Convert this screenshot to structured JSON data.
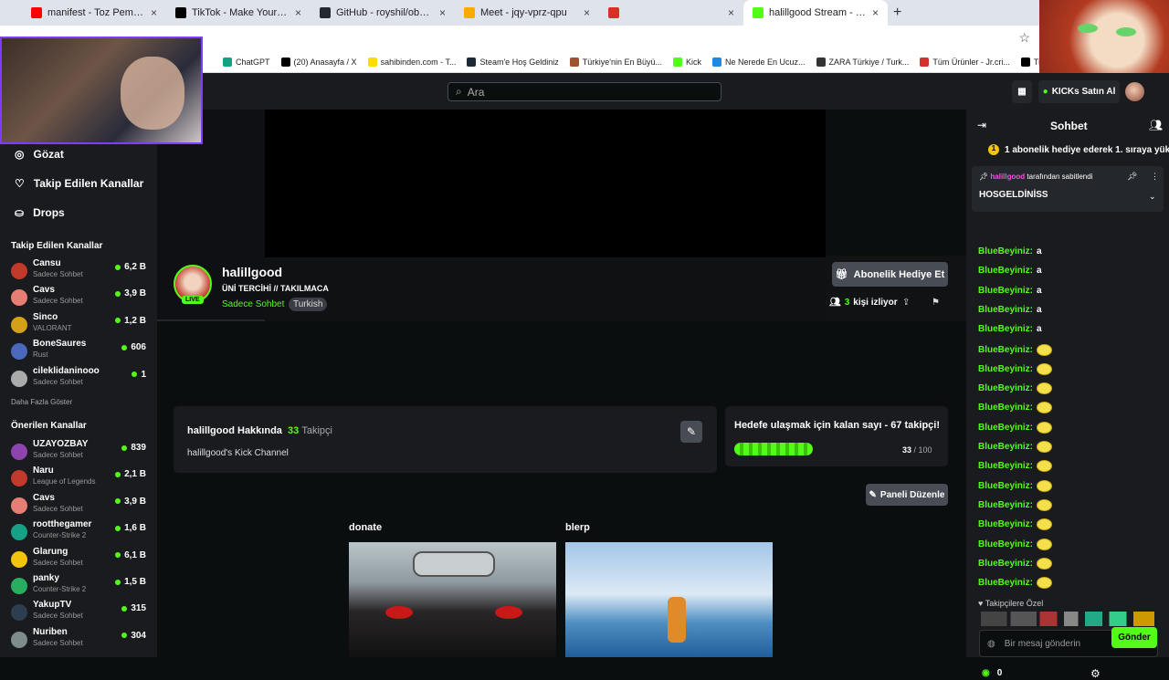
{
  "browser": {
    "tabs": [
      {
        "title": "manifest - Toz Pembe | Official",
        "color": "#ff0000"
      },
      {
        "title": "TikTok - Make Your Day",
        "color": "#000000"
      },
      {
        "title": "GitHub - royshil/obs-backgrou",
        "color": "#24292f"
      },
      {
        "title": "Meet - jqy-vprz-qpu",
        "color": "#f9ab00"
      },
      {
        "title": "",
        "color": "#d93025"
      },
      {
        "title": "halillgood Stream - Watch Live",
        "color": "#53fc18"
      }
    ],
    "bookmarks": [
      "ChatGPT",
      "(20) Anasayfa / X",
      "sahibinden.com - T...",
      "Steam'e Hoş Geldiniz",
      "Türkiye'nin En Büyü...",
      "Kick",
      "Ne Nerede En Ucuz...",
      "ZARA Türkiye / Turk...",
      "Tüm Ürünler - Jr.cri...",
      "TikTok - Make Your..."
    ]
  },
  "nav": {
    "search_placeholder": "Ara",
    "kicks_button": "KICKs Satın Al"
  },
  "sidebar": {
    "browse": "Gözat",
    "followed_nav": "Takip Edilen Kanallar",
    "drops": "Drops",
    "followed_header": "Takip Edilen Kanallar",
    "followed": [
      {
        "name": "Cansu",
        "cat": "Sadece Sohbet",
        "v": "6,2 B",
        "col": "#c0392b"
      },
      {
        "name": "Cavs",
        "cat": "Sadece Sohbet",
        "v": "3,9 B",
        "col": "#e67e73"
      },
      {
        "name": "Sinco",
        "cat": "VALORANT",
        "v": "1,2 B",
        "col": "#d4a017"
      },
      {
        "name": "BoneSaures",
        "cat": "Rust",
        "v": "606",
        "col": "#4a69bd"
      },
      {
        "name": "cileklidaninooo",
        "cat": "Sadece Sohbet",
        "v": "1",
        "col": "#aaaaaa"
      }
    ],
    "show_more": "Daha Fazla Göster",
    "recommended_header": "Önerilen Kanallar",
    "recommended": [
      {
        "name": "UZAYOZBAY",
        "cat": "Sadece Sohbet",
        "v": "839",
        "col": "#8e44ad"
      },
      {
        "name": "Naru",
        "cat": "League of Legends",
        "v": "2,1 B",
        "col": "#c0392b"
      },
      {
        "name": "Cavs",
        "cat": "Sadece Sohbet",
        "v": "3,9 B",
        "col": "#e67e73"
      },
      {
        "name": "rootthegamer",
        "cat": "Counter-Strike 2",
        "v": "1,6 B",
        "col": "#16a085"
      },
      {
        "name": "Glarung",
        "cat": "Sadece Sohbet",
        "v": "6,1 B",
        "col": "#f1c40f"
      },
      {
        "name": "panky",
        "cat": "Counter-Strike 2",
        "v": "1,5 B",
        "col": "#27ae60"
      },
      {
        "name": "YakupTV",
        "cat": "Sadece Sohbet",
        "v": "315",
        "col": "#2c3e50"
      },
      {
        "name": "Nuriben",
        "cat": "Sadece Sohbet",
        "v": "304",
        "col": "#7f8c8d"
      }
    ]
  },
  "stream": {
    "username": "halillgood",
    "title": "ÜNİ TERCİHİ // TAKILMACA",
    "category": "Sadece Sohbet",
    "tag": "Turkish",
    "live": "LIVE",
    "subscribe_gift": "Abonelik Hediye Et",
    "viewers": "3",
    "viewers_label": "kişi izliyor"
  },
  "about": {
    "heading": "halillgood Hakkında",
    "followers": "33",
    "followers_label": "Takipçi",
    "desc": "halillgood's Kick Channel"
  },
  "goal": {
    "text": "Hedefe ulaşmak için kalan sayı - 67 takipçi!",
    "current": "33",
    "target": "/ 100",
    "progress": 0.33
  },
  "panels": {
    "edit": "Paneli Düzenle",
    "items": [
      "donate",
      "blerp"
    ]
  },
  "chat": {
    "title": "Sohbet",
    "sub_banner": "1 abonelik hediye ederek 1. sıraya yük",
    "pinned_by": "halillgood",
    "pinned_by_suffix": "tarafından sabitlendi",
    "pinned_msg": "HOSGELDİNİSS",
    "messages": [
      {
        "user": "BlueBeyiniz:",
        "text": "a"
      },
      {
        "user": "BlueBeyiniz:",
        "text": "a"
      },
      {
        "user": "BlueBeyiniz:",
        "text": "a"
      },
      {
        "user": "BlueBeyiniz:",
        "text": "a"
      },
      {
        "user": "BlueBeyiniz:",
        "text": "a"
      },
      {
        "user": "BlueBeyiniz:",
        "text": ""
      },
      {
        "user": "BlueBeyiniz:",
        "text": ""
      },
      {
        "user": "BlueBeyiniz:",
        "text": ""
      },
      {
        "user": "BlueBeyiniz:",
        "text": ""
      },
      {
        "user": "BlueBeyiniz:",
        "text": ""
      },
      {
        "user": "BlueBeyiniz:",
        "text": ""
      },
      {
        "user": "BlueBeyiniz:",
        "text": ""
      },
      {
        "user": "BlueBeyiniz:",
        "text": ""
      },
      {
        "user": "BlueBeyiniz:",
        "text": ""
      },
      {
        "user": "BlueBeyiniz:",
        "text": ""
      },
      {
        "user": "BlueBeyiniz:",
        "text": ""
      },
      {
        "user": "BlueBeyiniz:",
        "text": ""
      },
      {
        "user": "BlueBeyiniz:",
        "text": ""
      }
    ],
    "followers_only": "Takipçilere Özel",
    "input_placeholder": "Bir mesaj gönderin",
    "points": "0",
    "send": "Gönder"
  },
  "colors": {
    "accent": "#53fc18",
    "bg": "#0b0e0f",
    "panel": "#191b1f"
  }
}
